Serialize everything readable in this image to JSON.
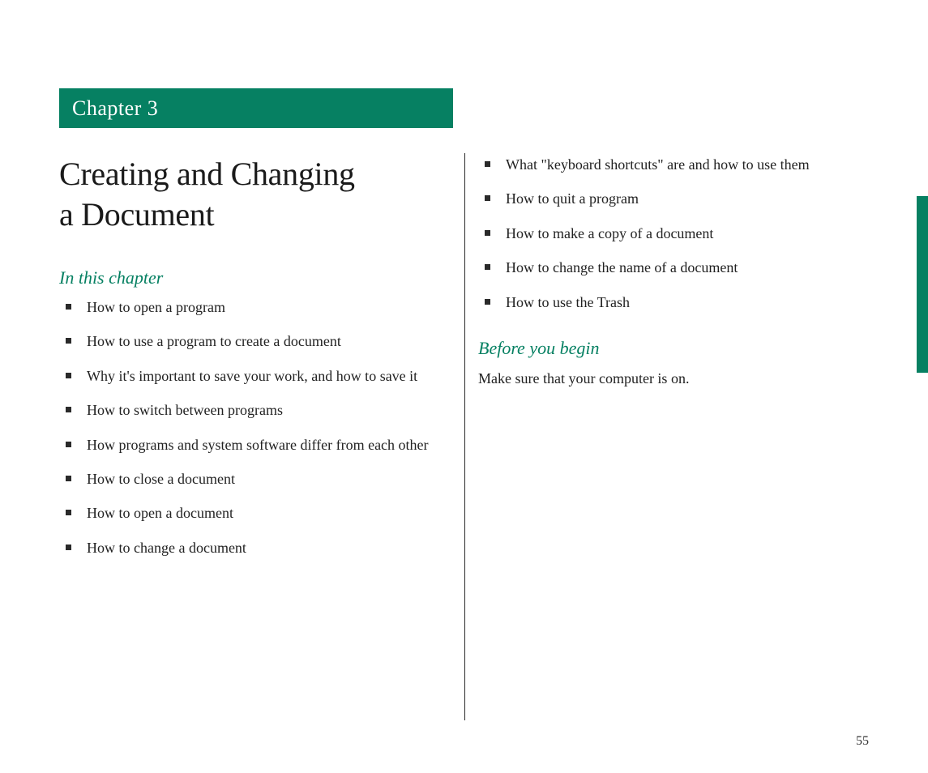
{
  "chapter_label": "Chapter 3",
  "chapter_title_line1": "Creating and Changing",
  "chapter_title_line2": "a Document",
  "section_in_this_chapter": "In this chapter",
  "bullets_left": [
    "How to open a program",
    "How to use a program to create a document",
    "Why it's important to save your work, and how to save it",
    "How to switch between programs",
    "How programs and system software differ from each other",
    "How to close a document",
    "How to open a document",
    "How to change a document"
  ],
  "bullets_right": [
    "What \"keyboard shortcuts\" are and how to use them",
    "How to quit a program",
    "How to make a copy of a document",
    "How to change the name of a document",
    "How to use the Trash"
  ],
  "section_before_you_begin": "Before you begin",
  "before_you_begin_text": "Make sure that your computer is on.",
  "page_number": "55",
  "colors": {
    "accent": "#068062",
    "text": "#222222"
  }
}
